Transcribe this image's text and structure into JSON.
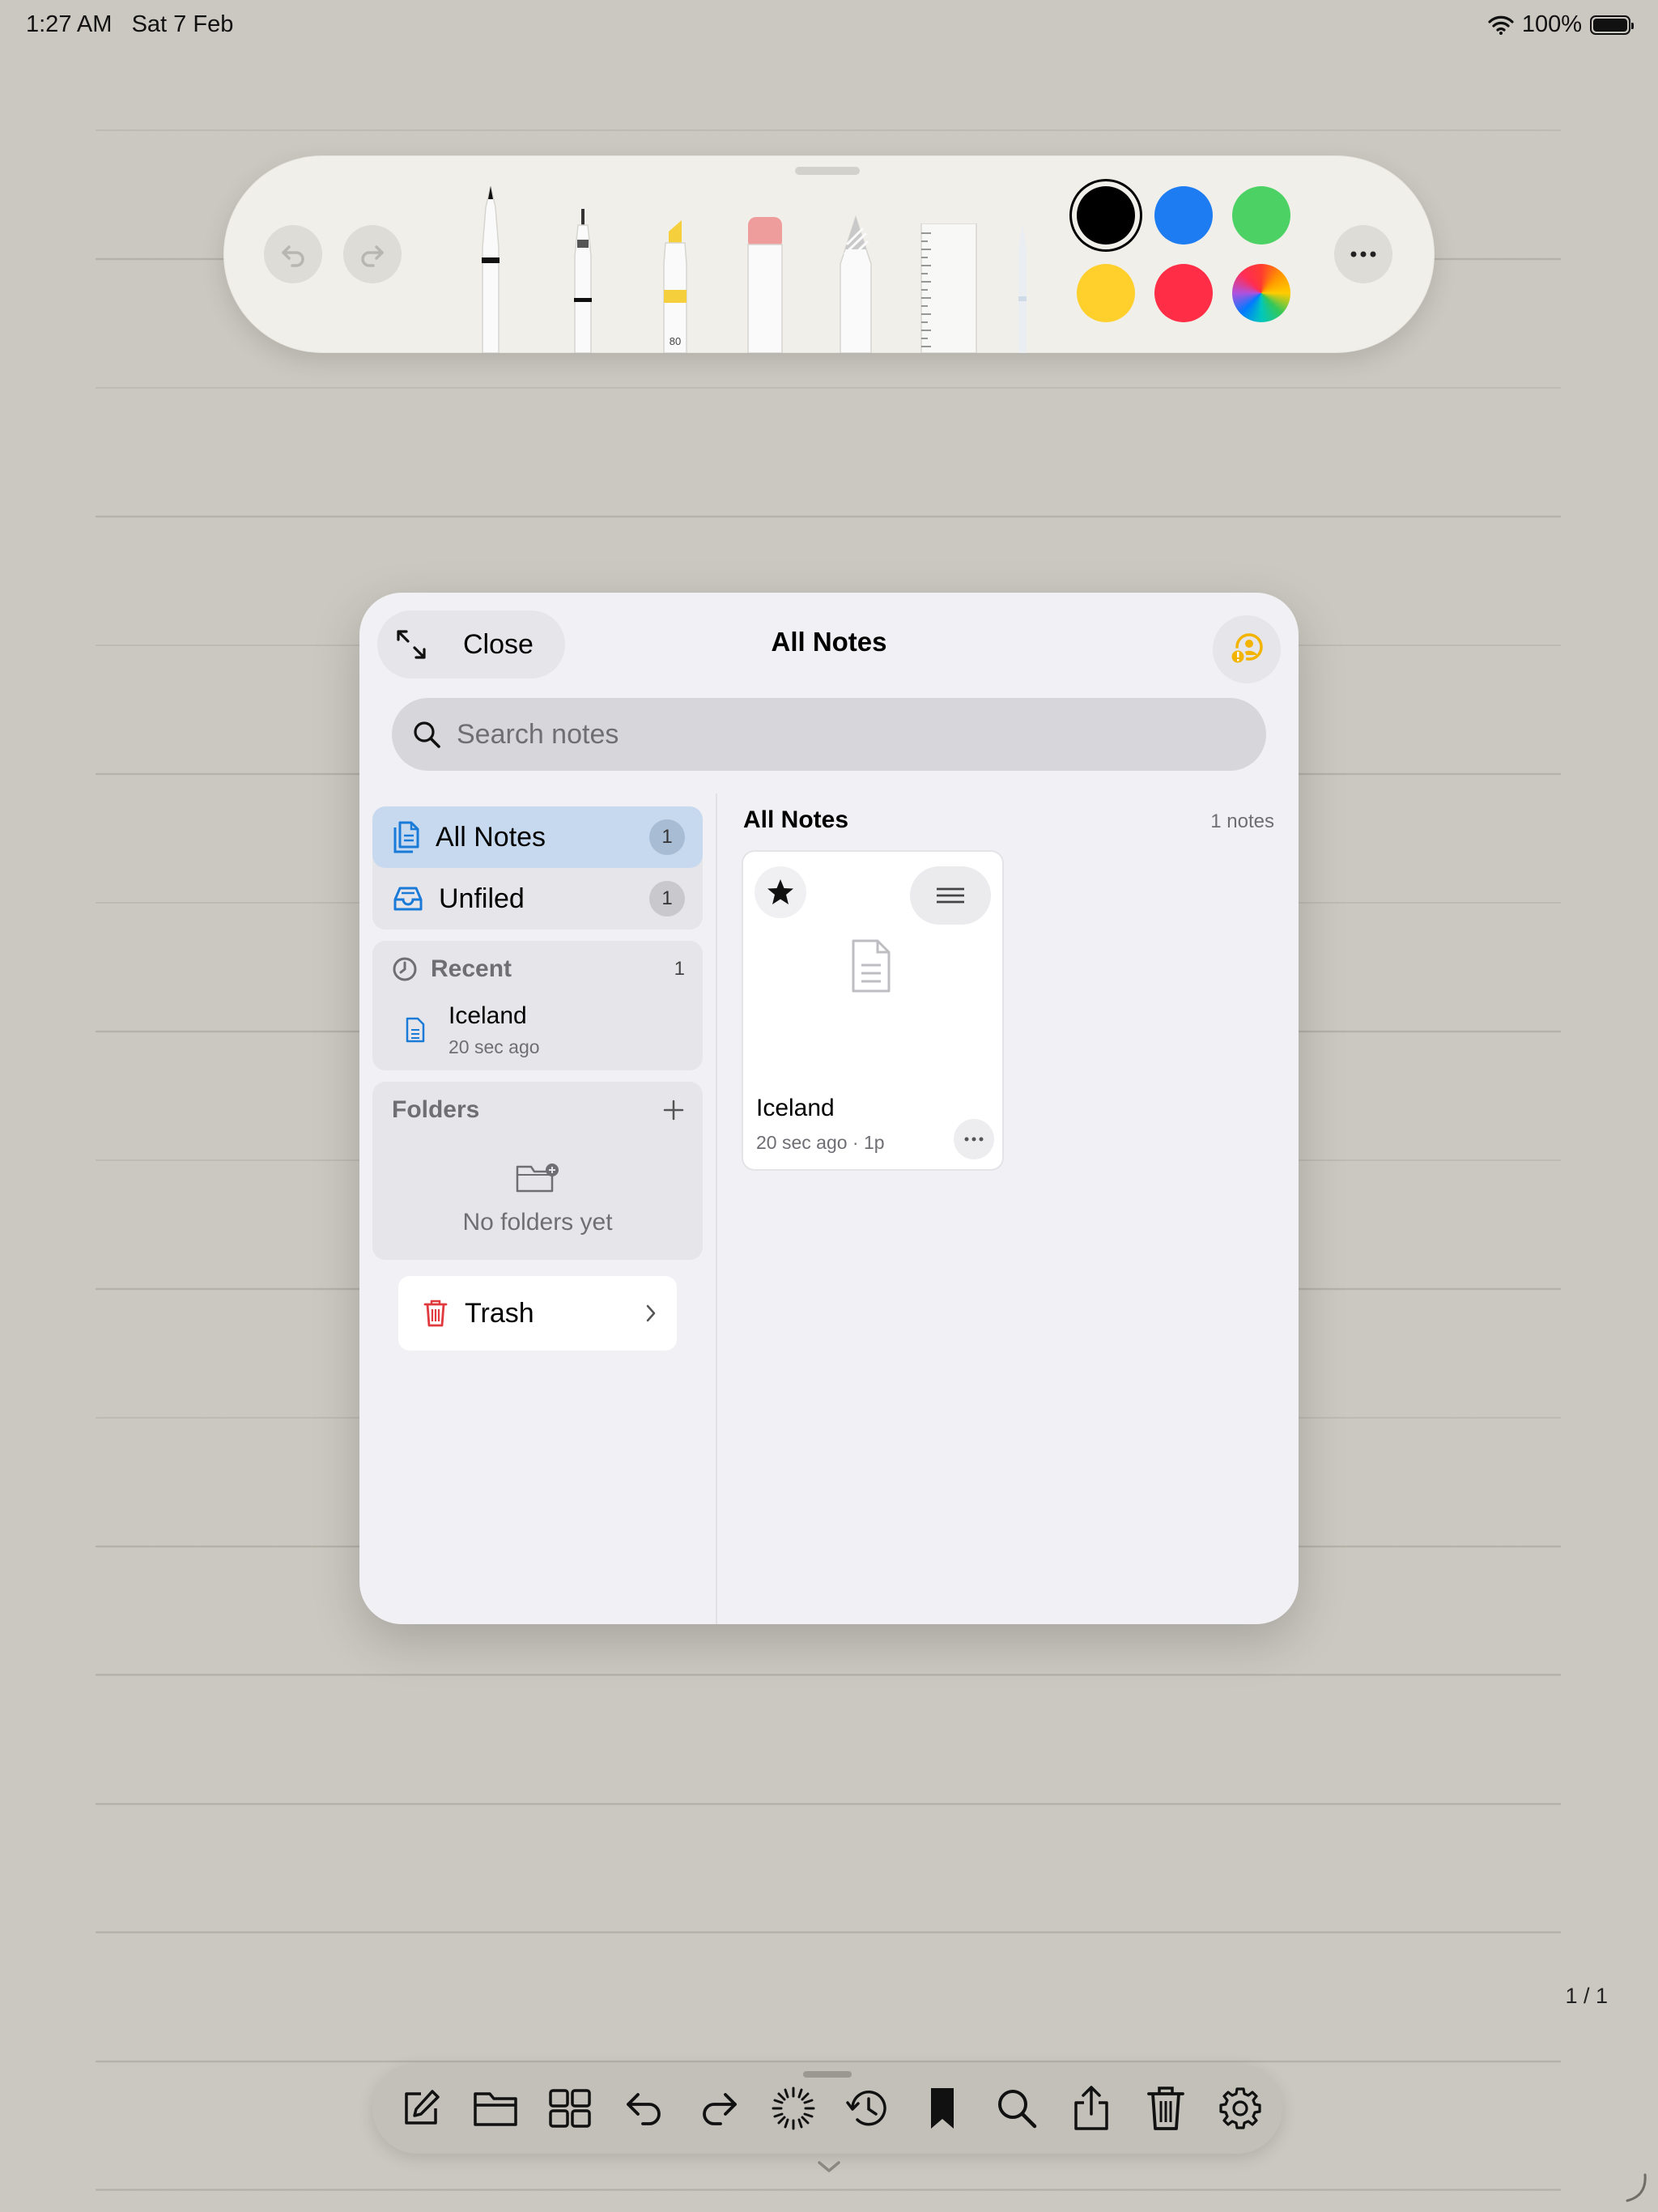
{
  "status_bar": {
    "time": "1:27 AM",
    "date": "Sat 7 Feb",
    "battery": "100%"
  },
  "palette": {
    "marker_number": "80",
    "colors": [
      "#000000",
      "#1d7cf2",
      "#4cd264",
      "#ffd02b",
      "#ff2d46"
    ]
  },
  "notes_panel": {
    "close_label": "Close",
    "title": "All Notes",
    "search_placeholder": "Search notes",
    "sidebar": {
      "all_notes": {
        "label": "All Notes",
        "count": "1"
      },
      "unfiled": {
        "label": "Unfiled",
        "count": "1"
      },
      "recent": {
        "label": "Recent",
        "count": "1",
        "item": {
          "name": "Iceland",
          "time": "20 sec ago"
        }
      },
      "folders": {
        "label": "Folders",
        "empty_text": "No folders yet"
      },
      "trash_label": "Trash"
    },
    "main": {
      "heading": "All Notes",
      "count_text": "1 notes",
      "notes": [
        {
          "title": "Iceland",
          "meta": "20 sec ago · 1p"
        }
      ]
    }
  },
  "page_indicator": "1 / 1",
  "accent_color": "#1a7ad8"
}
